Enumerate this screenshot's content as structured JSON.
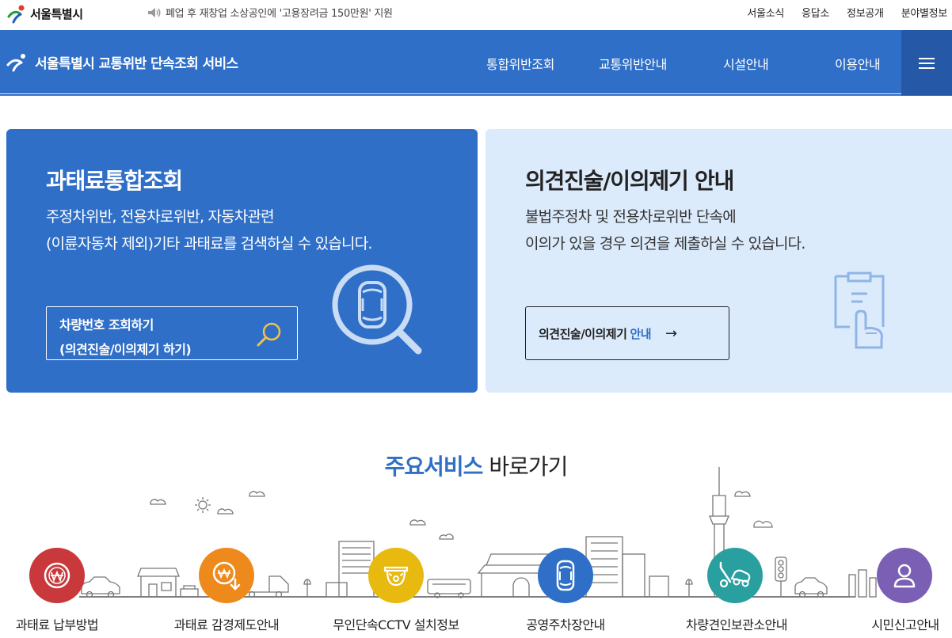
{
  "topbar": {
    "logo_text": "서울특별시",
    "notice": "폐업 후 재창업 소상공인에 '고용장려금 150만원' 지원",
    "links": [
      "서울소식",
      "응답소",
      "정보공개",
      "분야별정보"
    ]
  },
  "header": {
    "title": "서울특별시 교통위반 단속조회 서비스",
    "nav": [
      "통합위반조회",
      "교통위반안내",
      "시설안내",
      "이용안내"
    ]
  },
  "card_fine": {
    "title": "과태료통합조회",
    "desc_line1": "주정차위반, 전용차로위반, 자동차관련",
    "desc_line2": "(이륜자동차 제외)기타 과태료를 검색하실 수 있습니다.",
    "button_line1": "차량번호 조회하기",
    "button_line2": "(의견진술/이의제기 하기)"
  },
  "card_opinion": {
    "title": "의견진술/이의제기 안내",
    "desc_line1": "불법주정차 및 전용차로위반 단속에",
    "desc_line2": "이의가 있을 경우 의견을 제출하실 수 있습니다.",
    "button_main": "의견진술/이의제기",
    "button_accent": "안내",
    "button_arrow": "→"
  },
  "services": {
    "title_strong": "주요서비스",
    "title_light": "바로가기",
    "items": [
      {
        "label": "과태료 납부방법",
        "icon": "won-coin-icon",
        "color": "#c9393b"
      },
      {
        "label": "과태료 감경제도안내",
        "icon": "won-down-icon",
        "color": "#ee8a1c"
      },
      {
        "label": "무인단속CCTV 설치정보",
        "icon": "cctv-icon",
        "color": "#e8b90f"
      },
      {
        "label": "공영주차장안내",
        "icon": "car-top-icon",
        "color": "#2f6fc8"
      },
      {
        "label": "차량견인보관소안내",
        "icon": "tow-truck-icon",
        "color": "#2a9fa0"
      },
      {
        "label": "시민신고안내",
        "icon": "person-icon",
        "color": "#7a5fb4"
      }
    ]
  },
  "colors": {
    "primary": "#2f6fc8",
    "primary_dark": "#2558a6",
    "light_card": "#dcebfc"
  }
}
